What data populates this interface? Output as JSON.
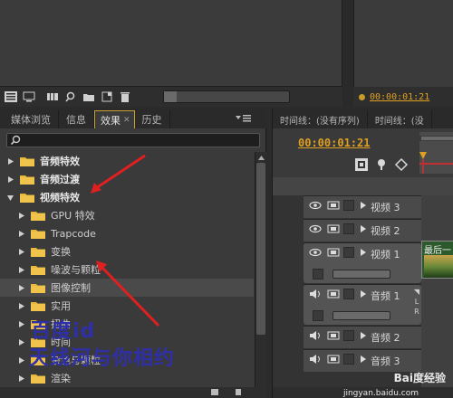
{
  "top": {
    "program_time": "00:00:01:21"
  },
  "effects_panel": {
    "tabs": [
      {
        "label": "媒体浏览"
      },
      {
        "label": "信息"
      },
      {
        "label": "效果"
      },
      {
        "label": "历史"
      }
    ],
    "search_value": "",
    "items": [
      {
        "label": "音频特效",
        "level": 0,
        "expanded": false,
        "bold": true
      },
      {
        "label": "音频过渡",
        "level": 0,
        "expanded": false,
        "bold": true
      },
      {
        "label": "视频特效",
        "level": 0,
        "expanded": true,
        "bold": true
      },
      {
        "label": "GPU 特效",
        "level": 1,
        "expanded": false,
        "bold": false
      },
      {
        "label": "Trapcode",
        "level": 1,
        "expanded": false,
        "bold": false
      },
      {
        "label": "变换",
        "level": 1,
        "expanded": false,
        "bold": false
      },
      {
        "label": "噪波与颗粒",
        "level": 1,
        "expanded": false,
        "bold": false
      },
      {
        "label": "图像控制",
        "level": 1,
        "expanded": false,
        "bold": false
      },
      {
        "label": "实用",
        "level": 1,
        "expanded": false,
        "bold": false
      },
      {
        "label": "扭曲",
        "level": 1,
        "expanded": false,
        "bold": false
      },
      {
        "label": "时间",
        "level": 1,
        "expanded": false,
        "bold": false
      },
      {
        "label": "杂色与颗粒",
        "level": 1,
        "expanded": false,
        "bold": false
      },
      {
        "label": "渲染",
        "level": 1,
        "expanded": false,
        "bold": false
      }
    ],
    "overlay_line1": "百度id",
    "overlay_line2": "天线河与你相约"
  },
  "timeline_panel": {
    "tabs": [
      {
        "label": "时间线：(没有序列)"
      },
      {
        "label": "时间线：(没"
      }
    ],
    "timecode": "00:00:01:21",
    "tracks": [
      {
        "label": "视频 3",
        "kind": "video"
      },
      {
        "label": "视频 2",
        "kind": "video"
      },
      {
        "label": "视频 1",
        "kind": "video"
      },
      {
        "label": "音频 1",
        "kind": "audio"
      },
      {
        "label": "音频 2",
        "kind": "audio"
      },
      {
        "label": "音频 3",
        "kind": "audio"
      }
    ],
    "clip_label": "最后一",
    "watermark": "Bai度经验",
    "watermark_sub": "jingyan.baidu.com"
  },
  "colors": {
    "accent": "#e0a020",
    "annotation_red": "#e02020",
    "overlay_blue": "#2f2fa8",
    "folder": "#e8b83a"
  }
}
